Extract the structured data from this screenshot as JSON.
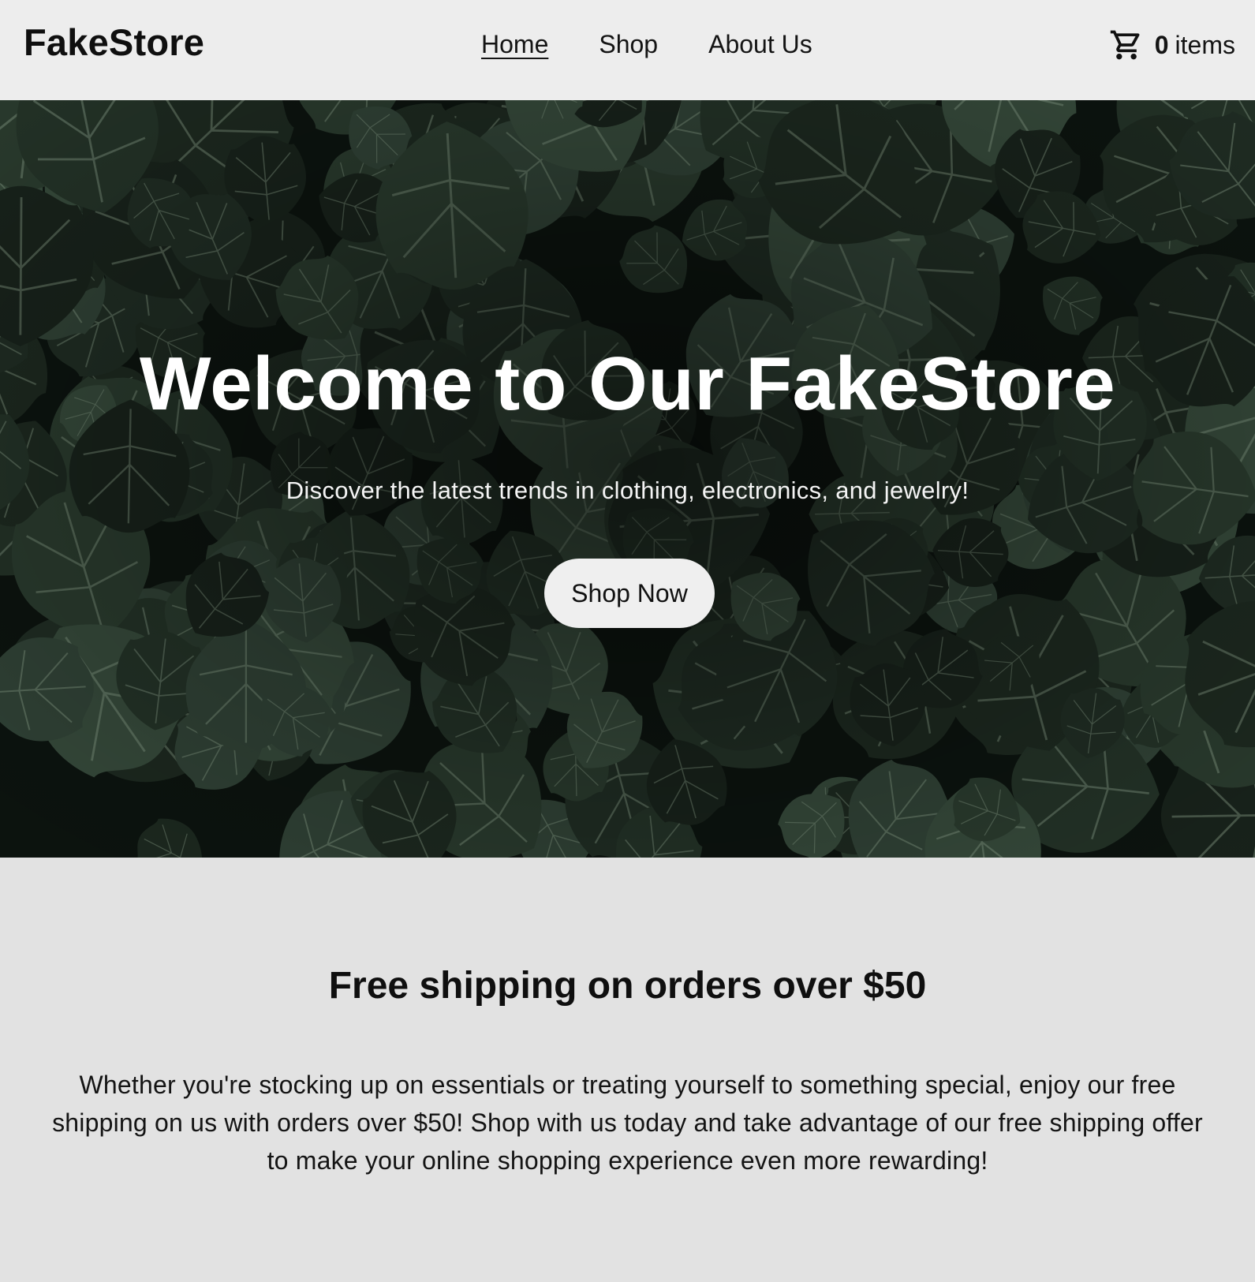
{
  "header": {
    "logo": "FakeStore",
    "nav": [
      {
        "label": "Home",
        "active": true
      },
      {
        "label": "Shop",
        "active": false
      },
      {
        "label": "About Us",
        "active": false
      }
    ],
    "cart": {
      "count": "0",
      "label": "items",
      "icon": "cart-icon"
    }
  },
  "hero": {
    "title": "Welcome to Our FakeStore",
    "subtitle": "Discover the latest trends in clothing, electronics, and jewelry!",
    "button_label": "Shop Now",
    "background": "ivy-leaves-photo"
  },
  "promo": {
    "title": "Free shipping on orders over $50",
    "body": "Whether you're stocking up on essentials or treating yourself to something special, enjoy our free shipping on us with orders over $50! Shop with us today and take advantage of our free shipping offer to make your online shopping experience even more rewarding!"
  },
  "colors": {
    "header_bg": "#ededed",
    "promo_bg": "#e2e2e2",
    "button_bg": "#efefef",
    "hero_text": "#ffffff"
  }
}
